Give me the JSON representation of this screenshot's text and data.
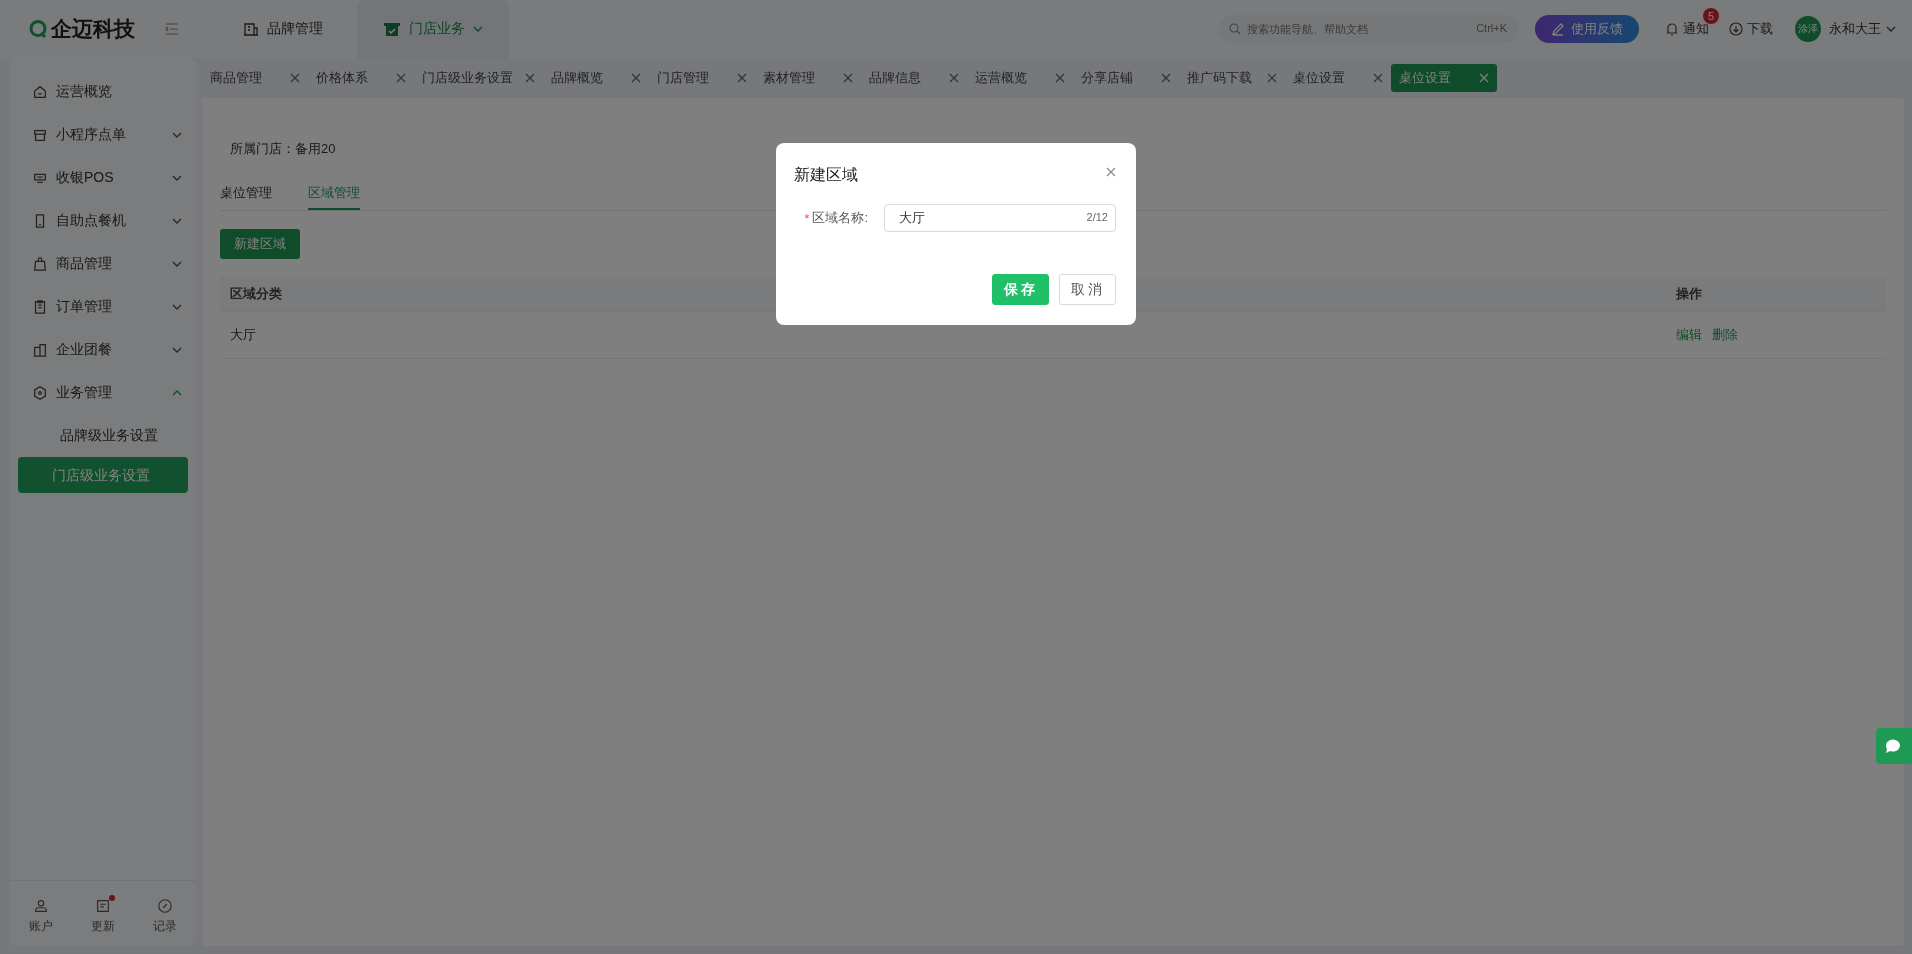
{
  "header": {
    "logo": "企迈科技",
    "nav": [
      {
        "label": "品牌管理",
        "selected": false
      },
      {
        "label": "门店业务",
        "selected": true
      }
    ],
    "search": {
      "placeholder": "搜索功能导航、帮助文档",
      "shortcut": "Ctrl+K"
    },
    "feedback": "使用反馈",
    "notifications": {
      "label": "通知",
      "badge": "5"
    },
    "download": "下载",
    "user": {
      "avatar": "涂泽",
      "name": "永和大王"
    }
  },
  "sidebar": {
    "items": [
      {
        "label": "运营概览",
        "kind": "link"
      },
      {
        "label": "小程序点单",
        "kind": "group",
        "expanded": false
      },
      {
        "label": "收银POS",
        "kind": "group",
        "expanded": false
      },
      {
        "label": "自助点餐机",
        "kind": "group",
        "expanded": false
      },
      {
        "label": "商品管理",
        "kind": "group",
        "expanded": false
      },
      {
        "label": "订单管理",
        "kind": "group",
        "expanded": false
      },
      {
        "label": "企业团餐",
        "kind": "group",
        "expanded": false
      },
      {
        "label": "业务管理",
        "kind": "group",
        "expanded": true,
        "children": [
          {
            "label": "品牌级业务设置",
            "selected": false
          },
          {
            "label": "门店级业务设置",
            "selected": true
          }
        ]
      }
    ],
    "footer": [
      {
        "label": "账户",
        "dot": false
      },
      {
        "label": "更新",
        "dot": true
      },
      {
        "label": "记录",
        "dot": false
      }
    ]
  },
  "tabs": [
    {
      "label": "商品管理",
      "selected": false
    },
    {
      "label": "价格体系",
      "selected": false
    },
    {
      "label": "门店级业务设置",
      "selected": false
    },
    {
      "label": "品牌概览",
      "selected": false
    },
    {
      "label": "门店管理",
      "selected": false
    },
    {
      "label": "素材管理",
      "selected": false
    },
    {
      "label": "品牌信息",
      "selected": false
    },
    {
      "label": "运营概览",
      "selected": false
    },
    {
      "label": "分享店铺",
      "selected": false
    },
    {
      "label": "推广码下载",
      "selected": false
    },
    {
      "label": "桌位设置",
      "selected": false
    },
    {
      "label": "桌位设置",
      "selected": true
    }
  ],
  "content": {
    "store": "所属门店：备用20",
    "subtabs": [
      {
        "label": "桌位管理",
        "selected": false
      },
      {
        "label": "区域管理",
        "selected": true
      }
    ],
    "new_button": "新建区域",
    "table": {
      "columns": [
        "区域分类",
        "操作"
      ],
      "rows": [
        {
          "cells": [
            "大厅"
          ],
          "actions": [
            "编辑",
            "删除"
          ]
        }
      ]
    }
  },
  "dialog": {
    "title": "新建区域",
    "field": {
      "required_mark": "*",
      "label": "区域名称:",
      "value": "大厅",
      "counter": "2/12"
    },
    "buttons": [
      {
        "label": "保存",
        "kind": "primary"
      },
      {
        "label": "取消",
        "kind": "default"
      }
    ]
  }
}
